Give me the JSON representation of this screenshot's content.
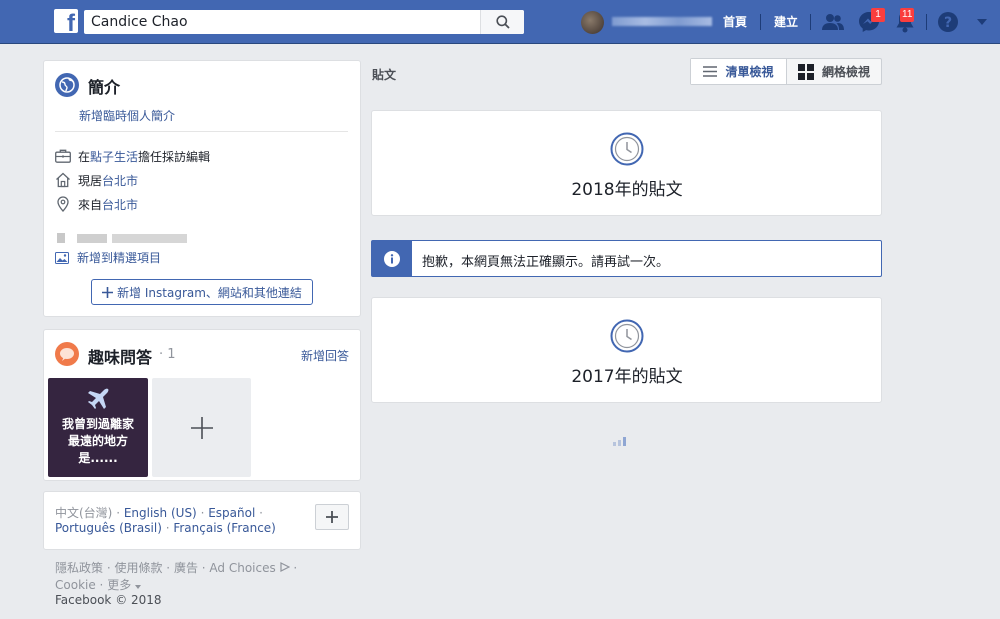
{
  "topbar": {
    "logo": "f",
    "search_value": "Candice Chao",
    "home_label": "首頁",
    "create_label": "建立",
    "messages_badge": "1",
    "notifications_badge": "11",
    "icons": [
      "friends-icon",
      "messenger-icon",
      "notifications-icon",
      "help-icon",
      "caret-down-icon"
    ]
  },
  "intro": {
    "title": "簡介",
    "add_bio": "新增臨時個人簡介",
    "work_prefix": "在",
    "work_place": "點子生活",
    "work_suffix": "擔任採訪編輯",
    "lives_prefix": "現居",
    "lives_city": "台北市",
    "from_prefix": "來自",
    "from_city": "台北市",
    "add_featured": "新增到精選項目",
    "add_links": "新增 Instagram、網站和其他連結"
  },
  "qa": {
    "title": "趣味問答",
    "count": "· 1",
    "add_answer": "新增回答",
    "tile_text_1": "我曾到過離家",
    "tile_text_2": "最遠的地方",
    "tile_text_3": "是......"
  },
  "languages": {
    "current": "中文(台灣)",
    "lang1": "English (US)",
    "lang2": "Español",
    "lang3": "Português (Brasil)",
    "lang4": "Français (France)"
  },
  "footer": {
    "privacy": "隱私政策",
    "terms": "使用條款",
    "ads": "廣告",
    "ad_choices": "Ad Choices",
    "cookie": "Cookie",
    "more": "更多",
    "copyright": "Facebook © 2018"
  },
  "posts": {
    "label": "貼文",
    "list_view": "清單檢視",
    "grid_view": "網格檢視",
    "year_2018": "2018年的貼文",
    "year_2017": "2017年的貼文",
    "error_message": "抱歉，本網頁無法正確顯示。請再試一次。"
  },
  "colors": {
    "brand_blue": "#4267b2",
    "link_blue": "#385898",
    "background": "#e9ebee",
    "badge_red": "#fa3e3e"
  }
}
